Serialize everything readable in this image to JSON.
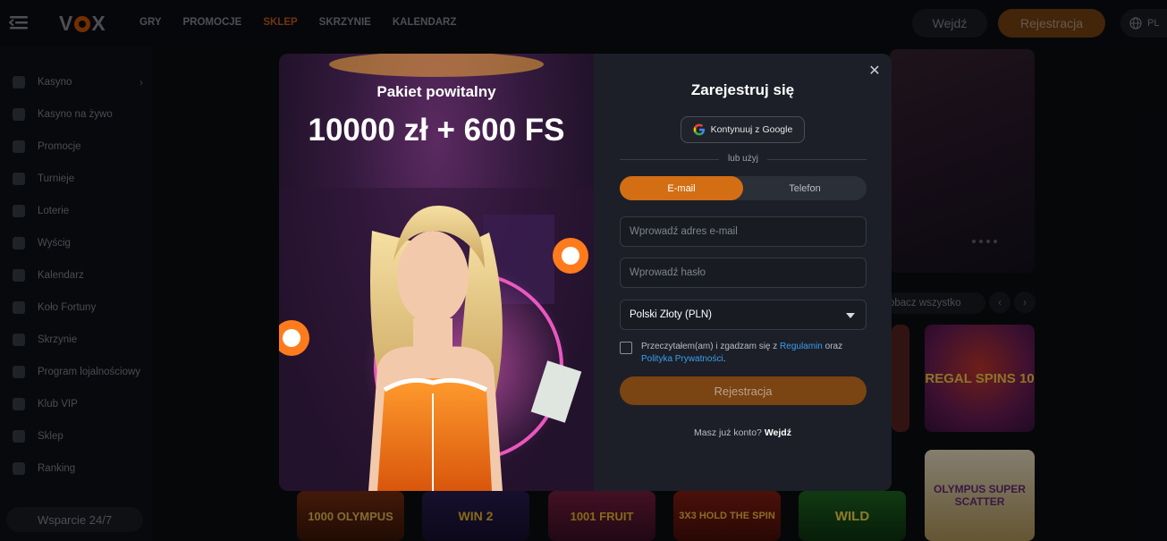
{
  "header": {
    "logo": "V X",
    "nav": [
      "GRY",
      "PROMOCJE",
      "SKLEP",
      "SKRZYNIE",
      "KALENDARZ"
    ],
    "active_nav": "SKLEP",
    "login_label": "Wejdź",
    "register_label": "Rejestracja",
    "language": "PL"
  },
  "sidebar": {
    "items": [
      {
        "label": "Kasyno",
        "icon": "cherries-icon"
      },
      {
        "label": "Kasyno na żywo",
        "icon": "roulette-icon"
      },
      {
        "label": "Promocje",
        "icon": "gift-icon"
      },
      {
        "label": "Turnieje",
        "icon": "trophy-icon"
      },
      {
        "label": "Loterie",
        "icon": "lottery-icon"
      },
      {
        "label": "Wyścig",
        "icon": "race-flag-icon"
      },
      {
        "label": "Kalendarz",
        "icon": "calendar-icon"
      },
      {
        "label": "Koło Fortuny",
        "icon": "wheel-icon"
      },
      {
        "label": "Skrzynie",
        "icon": "chest-icon"
      },
      {
        "label": "Program lojalnościowy",
        "icon": "loyalty-icon"
      },
      {
        "label": "Klub VIP",
        "icon": "diamond-icon"
      },
      {
        "label": "Sklep",
        "icon": "shop-bag-icon"
      },
      {
        "label": "Ranking",
        "icon": "ranking-icon"
      }
    ],
    "support_label": "Wsparcie 24/7"
  },
  "background": {
    "see_all_label": "obacz wszystko",
    "tiles": [
      "REGAL SPINS 10",
      "1000 OLYMPUS",
      "WIN 2",
      "1001 FRUIT",
      "3X3 HOLD THE SPIN",
      "WILD",
      "OLYMPUS SUPER SCATTER"
    ]
  },
  "promo": {
    "subtitle": "Pakiet powitalny",
    "headline": "10000 zł + 600 FS"
  },
  "form": {
    "title": "Zarejestruj się",
    "google_label": "Kontynuuj z Google",
    "or_label": "lub użyj",
    "tabs": [
      "E-mail",
      "Telefon"
    ],
    "active_tab": "E-mail",
    "email_placeholder": "Wprowadź adres e-mail",
    "password_placeholder": "Wprowadź hasło",
    "currency": "Polski Złoty (PLN)",
    "terms_prefix": "Przeczytałem(am) i zgadzam się z ",
    "terms_link": "Regulamin",
    "terms_middle": " oraz ",
    "privacy_link": "Polityka Prywatności",
    "terms_suffix": ".",
    "submit_label": "Rejestracja",
    "have_account": "Masz już konto? ",
    "login_link": "Wejdź"
  }
}
